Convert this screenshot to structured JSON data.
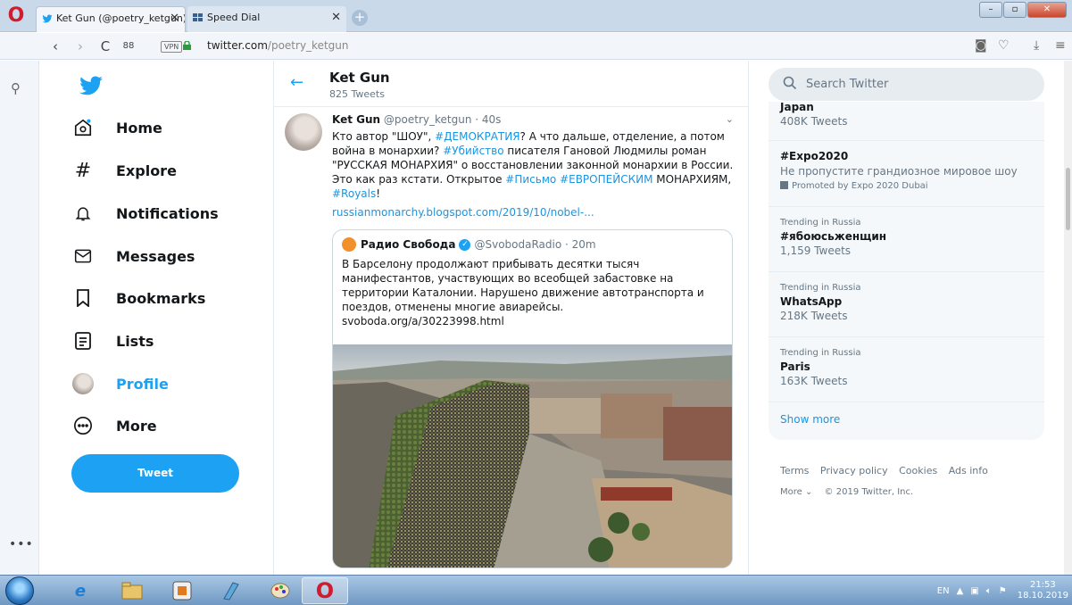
{
  "browser": {
    "tabs": [
      {
        "title": "Ket Gun (@poetry_ketgun)",
        "close": "✕",
        "active": true
      },
      {
        "title": "Speed Dial",
        "close": "✕",
        "active": false
      }
    ],
    "new_tab": "+",
    "window_controls": {
      "minimize": "–",
      "maximize": "▫",
      "close": "✕"
    },
    "tab_menu": "☰",
    "nav": {
      "back": "‹",
      "forward": "›",
      "reload": "C",
      "speed_dial": "88"
    },
    "vpn": "VPN",
    "url_domain": "twitter.com",
    "url_path": "/poetry_ketgun",
    "sidebar_more": "•••"
  },
  "twitter_nav": {
    "items": [
      {
        "label": "Home",
        "icon": "home-icon"
      },
      {
        "label": "Explore",
        "icon": "hashtag-icon"
      },
      {
        "label": "Notifications",
        "icon": "bell-icon"
      },
      {
        "label": "Messages",
        "icon": "envelope-icon"
      },
      {
        "label": "Bookmarks",
        "icon": "bookmark-icon"
      },
      {
        "label": "Lists",
        "icon": "list-icon"
      },
      {
        "label": "Profile",
        "icon": "avatar-icon"
      },
      {
        "label": "More",
        "icon": "more-icon"
      }
    ],
    "active": "Profile",
    "tweet_button": "Tweet"
  },
  "profile_header": {
    "back": "←",
    "name": "Ket Gun",
    "tweet_count": "825 Tweets"
  },
  "tweet": {
    "author": "Ket Gun",
    "handle": "@poetry_ketgun · 40s",
    "text_parts": [
      {
        "t": "Кто автор \"ШОУ\", ",
        "tag": false
      },
      {
        "t": "#ДЕМОКРАТИЯ",
        "tag": true
      },
      {
        "t": "? А что дальше, отделение, а потом война в монархии? ",
        "tag": false
      },
      {
        "t": "#Убийство",
        "tag": true
      },
      {
        "t": " писателя Гановой Людмилы роман \"РУССКАЯ МОНАРХИЯ\" о восстановлении законной монархии в России. Это как раз кстати. Открытое ",
        "tag": false
      },
      {
        "t": "#Письмо",
        "tag": true
      },
      {
        "t": " ",
        "tag": false
      },
      {
        "t": "#ЕВРОПЕЙСКИМ",
        "tag": true
      },
      {
        "t": " МОНАРХИЯМ, ",
        "tag": false
      },
      {
        "t": "#Royals",
        "tag": true
      },
      {
        "t": "!",
        "tag": false
      }
    ],
    "link": "russianmonarchy.blogspot.com/2019/10/nobel-...",
    "quote": {
      "name": "Радио Свобода",
      "handle": "@SvobodaRadio · 20m",
      "text": "В Барселону продолжают прибывать десятки тысяч манифестантов, участвующих во всеобщей забастовке на территории Каталонии. Нарушено движение автотранспорта и поездов, отменены многие авиарейсы.",
      "link": "svoboda.org/a/30223998.html"
    }
  },
  "search": {
    "placeholder": "Search Twitter"
  },
  "trends": [
    {
      "context": "",
      "name": "Japan",
      "count": "408K Tweets"
    },
    {
      "context": "",
      "name": "#Expo2020",
      "description": "Не пропустите грандиозное мировое шоу",
      "promoted": "Promoted by Expo 2020 Dubai"
    },
    {
      "context": "Trending in Russia",
      "name": "#ябоюсьженщин",
      "count": "1,159 Tweets"
    },
    {
      "context": "Trending in Russia",
      "name": "WhatsApp",
      "count": "218K Tweets"
    },
    {
      "context": "Trending in Russia",
      "name": "Paris",
      "count": "163K Tweets"
    }
  ],
  "show_more": "Show more",
  "footer": {
    "links": [
      "Terms",
      "Privacy policy",
      "Cookies",
      "Ads info"
    ],
    "more": "More ⌄",
    "copyright": "© 2019 Twitter, Inc."
  },
  "taskbar": {
    "lang": "EN",
    "time": "21:53",
    "date": "18.10.2019"
  },
  "colors": {
    "twitter_blue": "#1da1f2",
    "link": "#1b95e0",
    "opera_red": "#d01d2d"
  }
}
